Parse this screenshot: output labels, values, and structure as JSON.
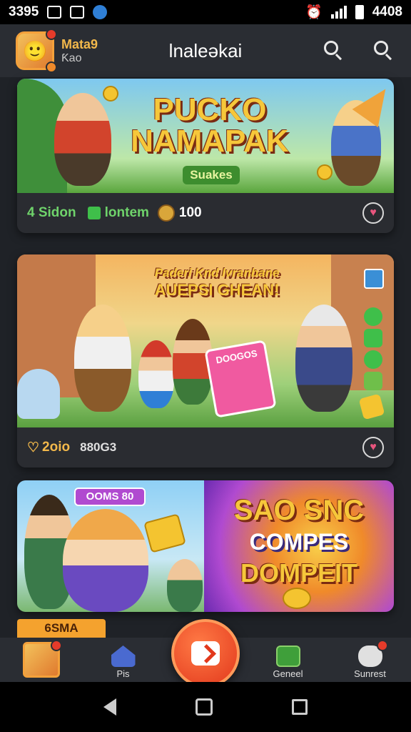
{
  "status_bar": {
    "time_left": "3395",
    "time_right": "4408"
  },
  "header": {
    "user_name": "Mata9",
    "user_sub": "Ƙao",
    "title": "lnaleəkai"
  },
  "cards": [
    {
      "title_line1": "PUCKO",
      "title_line2": "NAMAPAK",
      "subtitle": "Suakes",
      "stat1": "4 Sidon",
      "stat2": "lontem",
      "stat3": "100"
    },
    {
      "title_line1": "Paderi Knd lvranbane",
      "title_line2": "AUEPSI GHEAN!",
      "prize_label": "DOOGOS",
      "stat1": "2oio",
      "stat2": "880G3"
    },
    {
      "tag": "OOMS 80",
      "title_line1": "SAO SNC",
      "title_line2": "COMPES",
      "title_line3": "DOMPEIT"
    }
  ],
  "promo_tag": "6SMA",
  "bottom_nav": {
    "items": [
      {
        "label": ""
      },
      {
        "label": "Pis"
      },
      {
        "label": "Geneel"
      },
      {
        "label": "Sunrest"
      }
    ]
  },
  "colors": {
    "accent": "#e2381c",
    "gold": "#f2b84b",
    "background": "#1f2227"
  }
}
